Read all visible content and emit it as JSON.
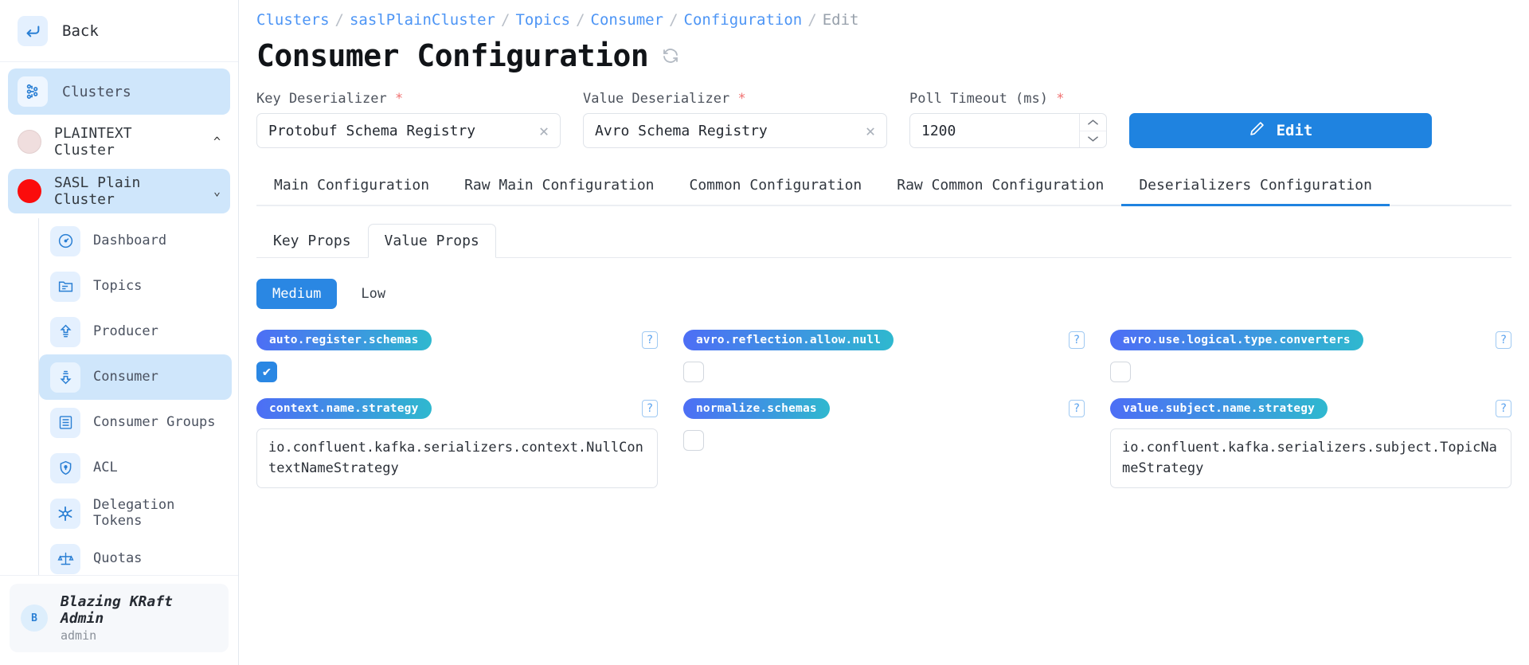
{
  "sidebar": {
    "back_label": "Back",
    "clusters_label": "Clusters",
    "clusters_icon": "cluster-nodes-icon",
    "back_icon": "arrow-left-icon",
    "cluster_items": [
      {
        "label": "PLAINTEXT Cluster",
        "chevron": "^",
        "active": false,
        "dot": "#f0dede"
      },
      {
        "label": "SASL Plain Cluster",
        "chevron": "⌄",
        "active": true,
        "dot": "#fb0c0c"
      }
    ],
    "submenu": [
      {
        "label": "Dashboard",
        "icon": "gauge-icon",
        "active": false
      },
      {
        "label": "Topics",
        "icon": "folder-icon",
        "active": false
      },
      {
        "label": "Producer",
        "icon": "upload-arrow-icon",
        "active": false
      },
      {
        "label": "Consumer",
        "icon": "download-arrow-icon",
        "active": true
      },
      {
        "label": "Consumer Groups",
        "icon": "server-list-icon",
        "active": false
      },
      {
        "label": "ACL",
        "icon": "shield-icon",
        "active": false
      },
      {
        "label": "Delegation Tokens",
        "icon": "asterisk-icon",
        "active": false
      },
      {
        "label": "Quotas",
        "icon": "scales-icon",
        "active": false
      }
    ],
    "user": {
      "initial": "B",
      "name": "Blazing KRaft Admin",
      "role": "admin"
    }
  },
  "breadcrumb": [
    {
      "label": "Clusters",
      "last": false
    },
    {
      "label": "saslPlainCluster",
      "last": false
    },
    {
      "label": "Topics",
      "last": false
    },
    {
      "label": "Consumer",
      "last": false
    },
    {
      "label": "Configuration",
      "last": false
    },
    {
      "label": "Edit",
      "last": true
    }
  ],
  "header": {
    "title": "Consumer Configuration",
    "refresh_icon": "refresh-icon"
  },
  "form": {
    "key_deserializer": {
      "label": "Key Deserializer",
      "required": "*",
      "value": "Protobuf Schema Registry",
      "clear_icon": "✕"
    },
    "value_deserializer": {
      "label": "Value Deserializer",
      "required": "*",
      "value": "Avro Schema Registry",
      "clear_icon": "✕"
    },
    "poll_timeout": {
      "label": "Poll Timeout (ms)",
      "required": "*",
      "value": "1200",
      "up_icon": "^",
      "down_icon": "⌄"
    },
    "edit_button": {
      "label": "Edit",
      "icon": "pencil-icon",
      "color": "#1f83e0"
    }
  },
  "tabs": [
    {
      "label": "Main Configuration",
      "active": false
    },
    {
      "label": "Raw Main Configuration",
      "active": false
    },
    {
      "label": "Common Configuration",
      "active": false
    },
    {
      "label": "Raw Common Configuration",
      "active": false
    },
    {
      "label": "Deserializers Configuration",
      "active": true
    }
  ],
  "subtabs": [
    {
      "label": "Key Props",
      "active": false
    },
    {
      "label": "Value Props",
      "active": true
    }
  ],
  "importance_pills": [
    {
      "label": "Medium",
      "active": true
    },
    {
      "label": "Low",
      "active": false
    }
  ],
  "properties": [
    {
      "name": "auto.register.schemas",
      "type": "checkbox",
      "checked": true,
      "help_icon": "?",
      "check_glyph": "✔"
    },
    {
      "name": "avro.reflection.allow.null",
      "type": "checkbox",
      "checked": false,
      "help_icon": "?"
    },
    {
      "name": "avro.use.logical.type.converters",
      "type": "checkbox",
      "checked": false,
      "help_icon": "?"
    },
    {
      "name": "context.name.strategy",
      "type": "text",
      "value": "io.confluent.kafka.serializers.context.NullContextNameStrategy",
      "help_icon": "?"
    },
    {
      "name": "normalize.schemas",
      "type": "checkbox",
      "checked": false,
      "help_icon": "?"
    },
    {
      "name": "value.subject.name.strategy",
      "type": "text",
      "value": "io.confluent.kafka.serializers.subject.TopicNameStrategy",
      "help_icon": "?"
    }
  ],
  "colors": {
    "accent": "#1f83e0",
    "chip_from": "#4d6ef5",
    "chip_to": "#2fb8cf",
    "active_nav_bg": "#cfe6fb",
    "breadcrumb_link": "#4d95f5"
  }
}
